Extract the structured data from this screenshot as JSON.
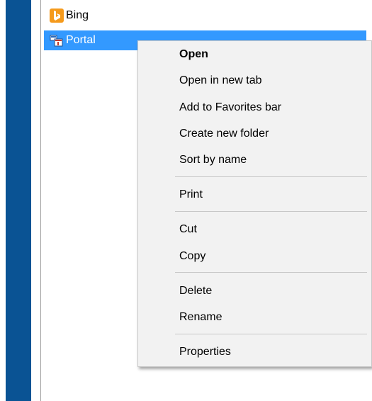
{
  "favorites": {
    "items": [
      {
        "label": "Bing",
        "icon": "bing-icon",
        "selected": false
      },
      {
        "label": "Portal",
        "icon": "portal-page-icon",
        "selected": true
      }
    ]
  },
  "context_menu": {
    "open": "Open",
    "open_new_tab": "Open in new tab",
    "add_favorites_bar": "Add to Favorites bar",
    "create_new_folder": "Create new folder",
    "sort_by_name": "Sort by name",
    "print": "Print",
    "cut": "Cut",
    "copy": "Copy",
    "delete": "Delete",
    "rename": "Rename",
    "properties": "Properties"
  },
  "colors": {
    "rail_blue": "#0a5394",
    "selection_blue": "#3399ff",
    "menu_background": "#f2f2f2",
    "bing_orange": "#f59a1c"
  }
}
